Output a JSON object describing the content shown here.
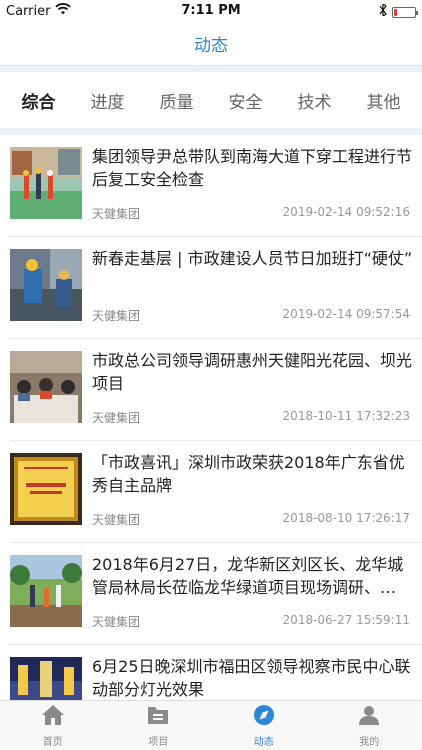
{
  "status": {
    "carrier": "Carrier",
    "time": "7:11 PM"
  },
  "nav": {
    "title": "动态"
  },
  "tabs": [
    "综合",
    "进度",
    "质量",
    "安全",
    "技术",
    "其他"
  ],
  "articles": [
    {
      "title": "集团领导尹总带队到南海大道下穿工程进行节后复工安全检查",
      "source": "天健集团",
      "time": "2019-02-14 09:52:16"
    },
    {
      "title": "新春走基层 | 市政建设人员节日加班打“硬仗”",
      "source": "天健集团",
      "time": "2019-02-14 09:57:54"
    },
    {
      "title": "市政总公司领导调研惠州天健阳光花园、坝光项目",
      "source": "天健集团",
      "time": "2018-10-11 17:32:23"
    },
    {
      "title": "「市政喜讯」深圳市政荣获2018年广东省优秀自主品牌",
      "source": "天健集团",
      "time": "2018-08-10 17:26:17"
    },
    {
      "title": "2018年6月27日，龙华新区刘区长、龙华城管局林局长莅临龙华绿道项目现场调研、…",
      "source": "天健集团",
      "time": "2018-06-27 15:59:11"
    },
    {
      "title": "6月25日晚深圳市福田区领导视察市民中心联动部分灯光效果",
      "source": "",
      "time": ""
    }
  ],
  "tabbar": [
    {
      "label": "首页",
      "icon": "home-icon"
    },
    {
      "label": "项目",
      "icon": "project-icon"
    },
    {
      "label": "动态",
      "icon": "compass-icon"
    },
    {
      "label": "我的",
      "icon": "user-icon"
    }
  ],
  "colors": {
    "accent": "#2e86d9",
    "battery_low": "#e53935"
  }
}
